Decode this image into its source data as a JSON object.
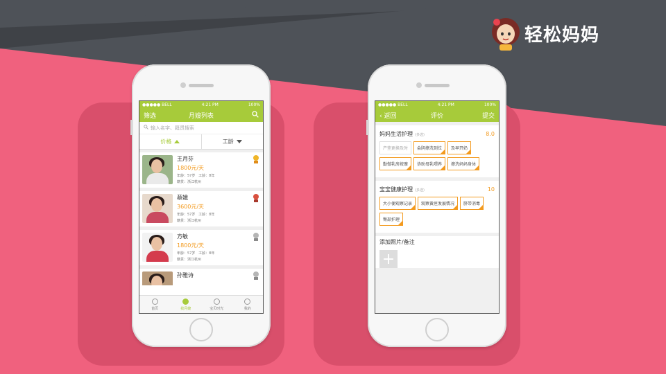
{
  "logo": {
    "text": "轻松妈妈",
    "icon": "mother-mascot-icon"
  },
  "colors": {
    "accent": "#a7cb3a",
    "price": "#f39a1e",
    "background": "#f0617e",
    "dark": "#4e5258"
  },
  "status_bar": {
    "carrier": "●●●●● BELL",
    "time": "4:21 PM",
    "battery": "100%"
  },
  "left_screen": {
    "nav": {
      "left": "筛选",
      "title": "月嫂列表",
      "right_icon": "search-icon"
    },
    "search": {
      "placeholder": "输入名字、籍贯搜索"
    },
    "sort": {
      "price": "价格",
      "experience": "工龄"
    },
    "nannies": [
      {
        "name": "王月芬",
        "price": "1800元/天",
        "age": "年龄：57岁",
        "exp": "工龄：8年",
        "origin": "籍贯：浙江杭州",
        "medal": "gold"
      },
      {
        "name": "蔡娥",
        "price": "3600元/天",
        "age": "年龄：57岁",
        "exp": "工龄：8年",
        "origin": "籍贯：浙江杭州",
        "medal": "red"
      },
      {
        "name": "方敏",
        "price": "1800元/天",
        "age": "年龄：57岁",
        "exp": "工龄：8年",
        "origin": "籍贯：浙江杭州",
        "medal": "silver"
      },
      {
        "name": "孙雅诗",
        "price": "",
        "age": "",
        "exp": "",
        "origin": "",
        "medal": "silver"
      }
    ],
    "tabs": [
      {
        "label": "首页",
        "icon": "home-icon"
      },
      {
        "label": "找月嫂",
        "icon": "search-nanny-icon",
        "active": true
      },
      {
        "label": "宝贝时光",
        "icon": "baby-icon"
      },
      {
        "label": "我的",
        "icon": "profile-icon"
      }
    ]
  },
  "right_screen": {
    "nav": {
      "left": "返回",
      "title": "评价",
      "right": "提交"
    },
    "sections": [
      {
        "title": "妈妈生活护理",
        "hint": "(多选)",
        "score": "8.0",
        "tags": [
          {
            "label": "产垫更换及时",
            "on": false
          },
          {
            "label": "会阴擦洗到位",
            "on": true
          },
          {
            "label": "及早开奶",
            "on": true
          },
          {
            "label": "勤做乳房按摩",
            "on": true
          },
          {
            "label": "协助母乳喂养",
            "on": true
          },
          {
            "label": "擦洗妈妈身体",
            "on": true
          }
        ]
      },
      {
        "title": "宝宝健康护理",
        "hint": "(多选)",
        "score": "10",
        "tags": [
          {
            "label": "大小便观察记录",
            "on": true
          },
          {
            "label": "观察黄疸发展情况",
            "on": true
          },
          {
            "label": "脐带消毒",
            "on": true
          },
          {
            "label": "臀部护理",
            "on": true
          }
        ]
      }
    ],
    "photo": {
      "title": "添加照片/备注",
      "add": "+"
    }
  }
}
